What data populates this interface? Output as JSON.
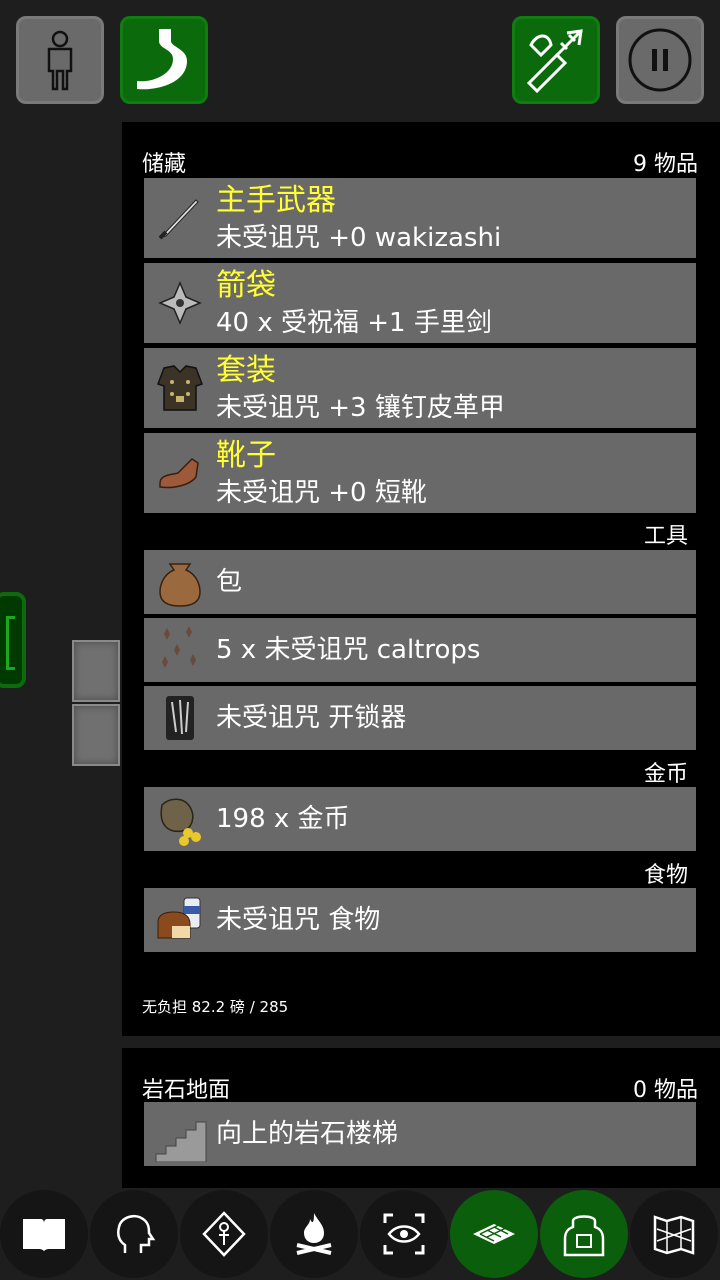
{
  "colors": {
    "slot_label": "#ffff33",
    "active_green": "#0b6a0b",
    "item_bg": "#696969",
    "panel_bg": "#000000"
  },
  "top_bar": {
    "left": [
      {
        "name": "character-button",
        "icon": "person-icon"
      },
      {
        "name": "hunger-button",
        "icon": "stomach-icon"
      }
    ],
    "right": [
      {
        "name": "quiver-button",
        "icon": "quiver-icon"
      },
      {
        "name": "pause-button",
        "icon": "pause-icon"
      }
    ]
  },
  "inventory": {
    "title": "储藏",
    "count": "9 物品",
    "equipped": [
      {
        "slot": "主手武器",
        "desc": "未受诅咒 +0 wakizashi",
        "icon": "wakizashi-icon"
      },
      {
        "slot": "箭袋",
        "desc": "40 x 受祝福 +1 手里剑",
        "icon": "shuriken-icon"
      },
      {
        "slot": "套装",
        "desc": "未受诅咒 +3 镶钉皮革甲",
        "icon": "studded-leather-armor-icon"
      },
      {
        "slot": "靴子",
        "desc": "未受诅咒 +0 短靴",
        "icon": "low-boots-icon"
      }
    ],
    "tools_label": "工具",
    "tools": [
      {
        "desc": "包",
        "icon": "sack-icon"
      },
      {
        "desc": "5 x 未受诅咒 caltrops",
        "icon": "caltrops-icon"
      },
      {
        "desc": "未受诅咒 开锁器",
        "icon": "lockpick-icon"
      }
    ],
    "gold_label": "金币",
    "gold": {
      "desc": "198 x 金币",
      "icon": "gold-pouch-icon"
    },
    "food_label": "食物",
    "food": {
      "desc": "未受诅咒 食物",
      "icon": "food-ration-icon"
    },
    "burden": "无负担 82.2 磅 / 285"
  },
  "floor": {
    "title": "岩石地面",
    "count": "0 物品",
    "items": [
      {
        "desc": "向上的岩石楼梯",
        "icon": "stairs-up-icon"
      }
    ]
  },
  "bottom_bar": [
    {
      "name": "spellbook-button",
      "icon": "book-icon",
      "active": false
    },
    {
      "name": "head-button",
      "icon": "head-icon",
      "active": false
    },
    {
      "name": "pray-button",
      "icon": "ankh-diamond-icon",
      "active": false
    },
    {
      "name": "rest-button",
      "icon": "campfire-icon",
      "active": false
    },
    {
      "name": "look-button",
      "icon": "eye-target-icon",
      "active": false
    },
    {
      "name": "floor-button",
      "icon": "floor-tiles-icon",
      "active": true
    },
    {
      "name": "inventory-button",
      "icon": "backpack-icon",
      "active": true
    },
    {
      "name": "map-button",
      "icon": "map-icon",
      "active": false
    }
  ]
}
